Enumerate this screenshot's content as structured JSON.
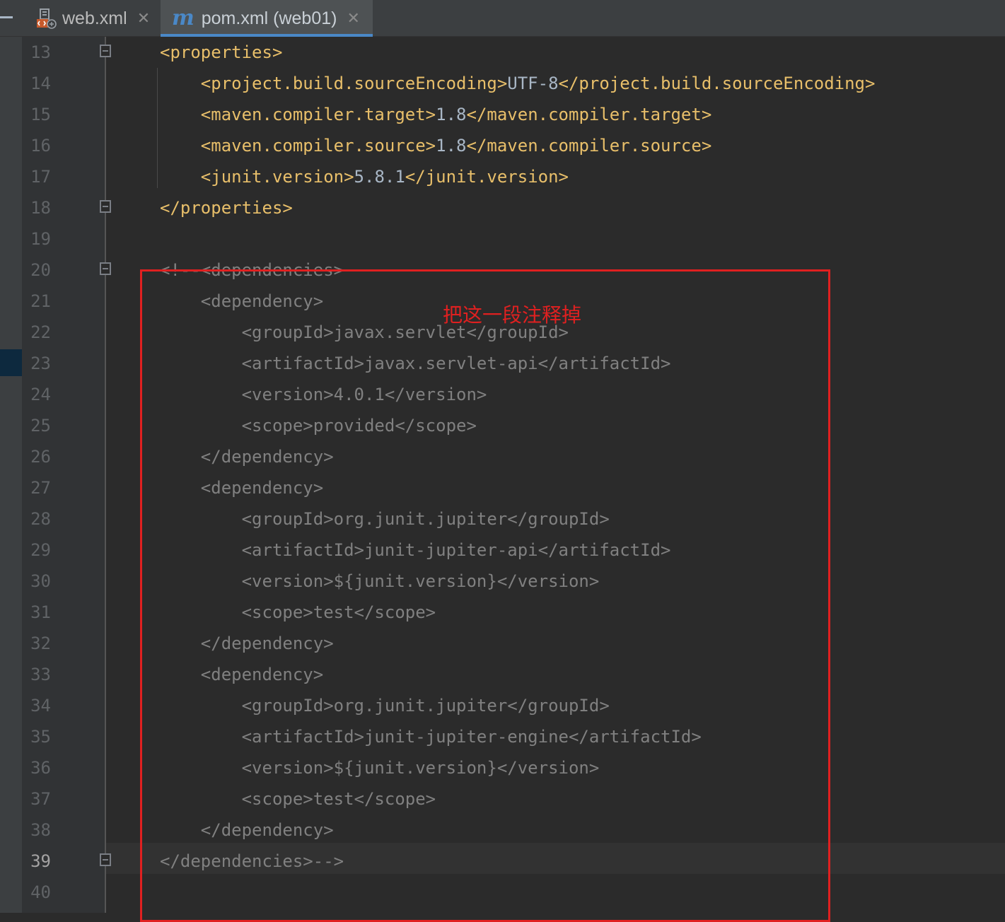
{
  "tabs": [
    {
      "label": "web.xml",
      "icon": "web-xml-file-icon",
      "active": false
    },
    {
      "label": "pom.xml (web01)",
      "icon": "maven-icon",
      "icon_glyph": "m",
      "active": true
    }
  ],
  "editor": {
    "current_line": "39",
    "lines": [
      {
        "number": "13",
        "indent": "",
        "tag_open": "<properties>",
        "text": "",
        "tag_close": "",
        "fold": true
      },
      {
        "number": "14",
        "indent": "    ",
        "tag_open": "<project.build.sourceEncoding>",
        "text": "UTF-8",
        "tag_close": "</project.build.sourceEncoding>",
        "fold": false
      },
      {
        "number": "15",
        "indent": "    ",
        "tag_open": "<maven.compiler.target>",
        "text": "1.8",
        "tag_close": "</maven.compiler.target>",
        "fold": false
      },
      {
        "number": "16",
        "indent": "    ",
        "tag_open": "<maven.compiler.source>",
        "text": "1.8",
        "tag_close": "</maven.compiler.source>",
        "fold": false
      },
      {
        "number": "17",
        "indent": "    ",
        "tag_open": "<junit.version>",
        "text": "5.8.1",
        "tag_close": "</junit.version>",
        "fold": false
      },
      {
        "number": "18",
        "indent": "",
        "tag_open": "</properties>",
        "text": "",
        "tag_close": "",
        "fold": true
      },
      {
        "number": "19",
        "comment": "",
        "fold": false
      },
      {
        "number": "20",
        "comment": "<!--<dependencies>",
        "fold": true
      },
      {
        "number": "21",
        "comment": "    <dependency>",
        "fold": false
      },
      {
        "number": "22",
        "comment": "        <groupId>javax.servlet</groupId>",
        "fold": false
      },
      {
        "number": "23",
        "comment": "        <artifactId>javax.servlet-api</artifactId>",
        "fold": false
      },
      {
        "number": "24",
        "comment": "        <version>4.0.1</version>",
        "fold": false
      },
      {
        "number": "25",
        "comment": "        <scope>provided</scope>",
        "fold": false
      },
      {
        "number": "26",
        "comment": "    </dependency>",
        "fold": false
      },
      {
        "number": "27",
        "comment": "    <dependency>",
        "fold": false
      },
      {
        "number": "28",
        "comment": "        <groupId>org.junit.jupiter</groupId>",
        "fold": false
      },
      {
        "number": "29",
        "comment": "        <artifactId>junit-jupiter-api</artifactId>",
        "fold": false
      },
      {
        "number": "30",
        "comment": "        <version>${junit.version}</version>",
        "fold": false
      },
      {
        "number": "31",
        "comment": "        <scope>test</scope>",
        "fold": false
      },
      {
        "number": "32",
        "comment": "    </dependency>",
        "fold": false
      },
      {
        "number": "33",
        "comment": "    <dependency>",
        "fold": false
      },
      {
        "number": "34",
        "comment": "        <groupId>org.junit.jupiter</groupId>",
        "fold": false
      },
      {
        "number": "35",
        "comment": "        <artifactId>junit-jupiter-engine</artifactId>",
        "fold": false
      },
      {
        "number": "36",
        "comment": "        <version>${junit.version}</version>",
        "fold": false
      },
      {
        "number": "37",
        "comment": "        <scope>test</scope>",
        "fold": false
      },
      {
        "number": "38",
        "comment": "    </dependency>",
        "fold": false
      },
      {
        "number": "39",
        "comment": "</dependencies>-->",
        "fold": true
      },
      {
        "number": "40",
        "comment": "",
        "fold": false
      }
    ]
  },
  "annotation": {
    "text": "把这一段注释掉",
    "color": "#e02020"
  },
  "colors": {
    "editor_bg": "#2b2b2b",
    "tag": "#e8bf6a",
    "text": "#a9b7c6",
    "comment": "#808080",
    "line_number": "#606366",
    "tab_underline": "#4a88c7"
  }
}
